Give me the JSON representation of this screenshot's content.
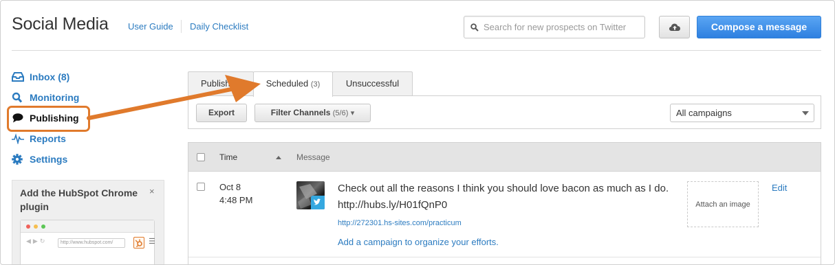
{
  "header": {
    "title": "Social Media",
    "links": [
      "User Guide",
      "Daily Checklist"
    ],
    "search_placeholder": "Search for new prospects on Twitter",
    "upload_icon": "cloud-upload-icon",
    "compose_label": "Compose a message"
  },
  "sidebar": {
    "items": [
      {
        "label": "Inbox (8)",
        "icon": "inbox-tray-icon"
      },
      {
        "label": "Monitoring",
        "icon": "search-icon"
      },
      {
        "label": "Publishing",
        "icon": "speech-bubble-icon",
        "active": true
      },
      {
        "label": "Reports",
        "icon": "pulse-icon"
      },
      {
        "label": "Settings",
        "icon": "gear-icon"
      }
    ],
    "plugin_panel": {
      "title": "Add the HubSpot Chrome plugin",
      "close": "×",
      "url_text": "http://www.hubspot.com/"
    }
  },
  "tabs": [
    {
      "label": "Publishe",
      "count": ""
    },
    {
      "label": "Scheduled",
      "count": "(3)",
      "active": true
    },
    {
      "label": "Unsuccessful",
      "count": ""
    }
  ],
  "toolbar": {
    "export_label": "Export",
    "filter_label": "Filter Channels",
    "filter_count": "(5/6)",
    "filter_caret": "▾",
    "campaign_select": "All campaigns"
  },
  "table": {
    "columns": [
      "Time",
      "Message"
    ],
    "rows": [
      {
        "date": "Oct 8",
        "time": "4:48 PM",
        "message": "Check out all the reasons I think you should love bacon as much as I do. http://hubs.ly/H01fQnP0",
        "link": "http://272301.hs-sites.com/practicum",
        "campaign_prompt": "Add a campaign to organize your efforts.",
        "attach_label": "Attach an image",
        "edit_label": "Edit"
      }
    ]
  },
  "colors": {
    "accent": "#2b7bc0",
    "compose_blue": "#3b8ce6",
    "annotation_orange": "#e07a2c",
    "twitter_blue": "#35a8e0"
  }
}
